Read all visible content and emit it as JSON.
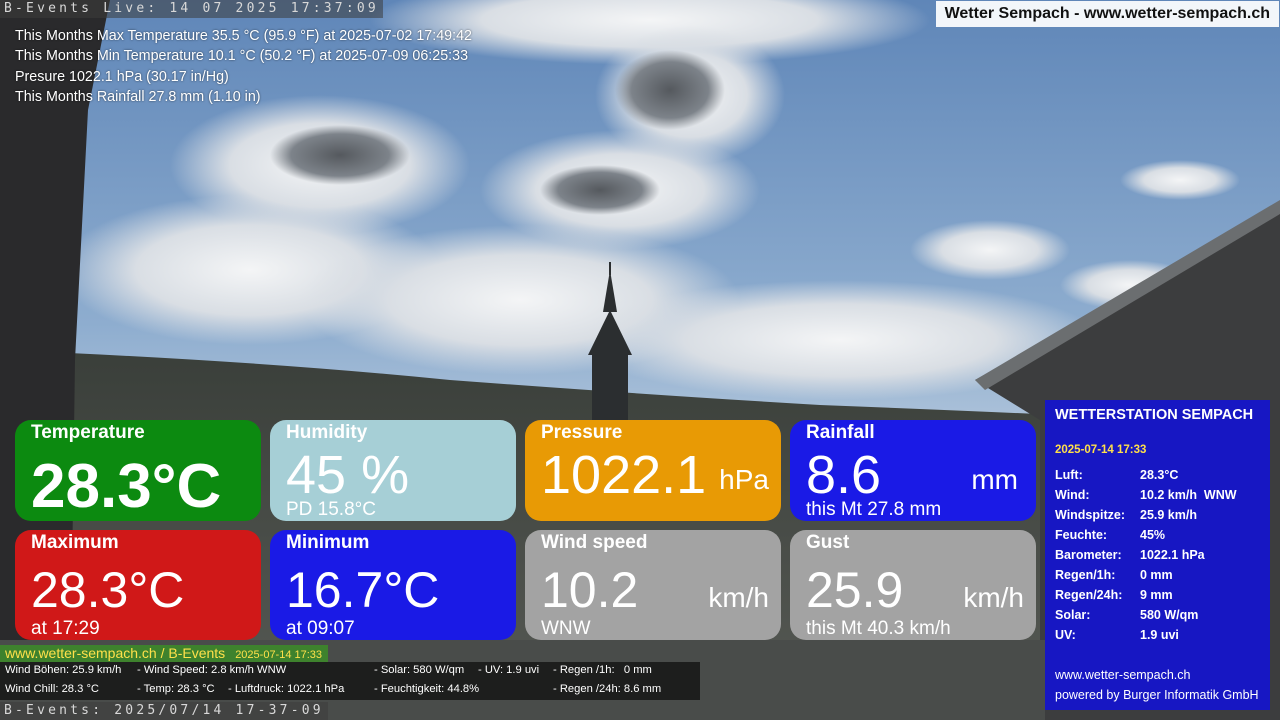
{
  "header": {
    "stamp_top": "B-Events Live: 14 07 2025 17:37:09",
    "stamp_bottom": "B-Events: 2025/07/14 17-37-09",
    "site_badge": "Wetter Sempach - www.wetter-sempach.ch"
  },
  "month_stats": [
    "This Months Max Temperature 35.5 °C (95.9 °F) at 2025-07-02 17:49:42",
    "This Months Min Temperature 10.1 °C (50.2 °F) at 2025-07-09 06:25:33",
    "Presure 1022.1 hPa (30.17 in/Hg)",
    "This Months Rainfall 27.8 mm (1.10 in)"
  ],
  "tiles": {
    "temperature": {
      "title": "Temperature",
      "value": "28.3°C",
      "color": "#0c8a10"
    },
    "humidity": {
      "title": "Humidity",
      "value": "45 %",
      "sub": "PD 15.8°C",
      "color": "#a6cfd6"
    },
    "pressure": {
      "title": "Pressure",
      "value": "1022.1",
      "unit": "hPa",
      "color": "#e89a05"
    },
    "rainfall": {
      "title": "Rainfall",
      "value": "8.6",
      "unit": "mm",
      "sub": "this Mt 27.8 mm",
      "color": "#1a1ae6"
    },
    "maximum": {
      "title": "Maximum",
      "value": "28.3°C",
      "sub": "at 17:29",
      "color": "#d01818"
    },
    "minimum": {
      "title": "Minimum",
      "value": "16.7°C",
      "sub": "at 09:07",
      "color": "#1a1ae6"
    },
    "wind_speed": {
      "title": "Wind speed",
      "value": "10.2",
      "unit": "km/h",
      "sub": "WNW",
      "color": "#a3a3a3"
    },
    "gust": {
      "title": "Gust",
      "value": "25.9",
      "unit": "km/h",
      "sub": "this Mt 40.3 km/h",
      "color": "#a3a3a3"
    }
  },
  "station_panel": {
    "title": "WETTERSTATION SEMPACH",
    "date": "2025-07-14 17:33",
    "rows": [
      {
        "label": "Luft:",
        "value": "28.3°C"
      },
      {
        "label": "Wind:",
        "value": "10.2 km/h  WNW"
      },
      {
        "label": "Windspitze:",
        "value": "25.9 km/h"
      },
      {
        "label": "Feuchte:",
        "value": "45%"
      },
      {
        "label": "Barometer:",
        "value": "1022.1 hPa"
      },
      {
        "label": "Regen/1h:",
        "value": "0 mm"
      },
      {
        "label": "Regen/24h:",
        "value": "9 mm"
      },
      {
        "label": "Solar:",
        "value": "580 W/qm"
      },
      {
        "label": "UV:",
        "value": "1.9 uvi"
      }
    ],
    "website": "www.wetter-sempach.ch",
    "powered_by": "powered by Burger Informatik GmbH"
  },
  "bottom_bar": {
    "link": "www.wetter-sempach.ch / B-Events",
    "date": "2025-07-14 17:33"
  },
  "ticker": {
    "gust": "Wind Böhen: 25.9 km/h",
    "wind_speed": "- Wind Speed: 2.8 km/h WNW",
    "solar": "- Solar: 580 W/qm",
    "uv": "- UV: 1.9 uvi",
    "rain_1h": "- Regen /1h:   0 mm",
    "wind_chill": "Wind Chill: 28.3 °C",
    "temp": "- Temp: 28.3 °C",
    "pressure": "- Luftdruck: 1022.1 hPa",
    "humidity": "- Feuchtigkeit: 44.8%",
    "rain_24h": "- Regen /24h: 8.6 mm"
  }
}
